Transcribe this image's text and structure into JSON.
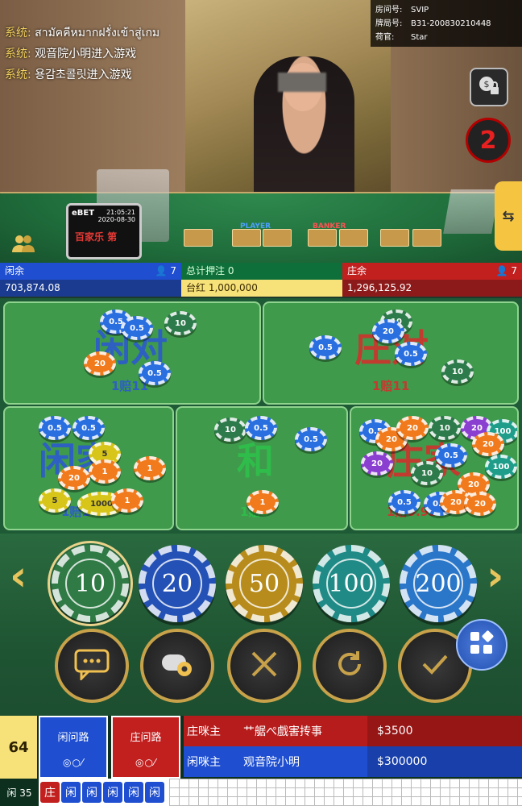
{
  "system_messages": [
    {
      "label": "系统:",
      "text": "สามัคคีหมากฝรั่งเข้าสู่เกม"
    },
    {
      "label": "系统:",
      "text": "观音院小明进入游戏"
    },
    {
      "label": "系统:",
      "text": "용감초콜릿进入游戏"
    }
  ],
  "room": {
    "room_label": "房间号:",
    "room_value": "SVIP",
    "shoe_label": "牌局号:",
    "shoe_value": "B31-200830210448",
    "dealer_label": "荷官:",
    "dealer_value": "Star"
  },
  "screen": {
    "logo": "eBET",
    "time": "21:05:21",
    "date": "2020-08-30",
    "subtitle": "百家乐 第"
  },
  "countdown": "2",
  "table_labels": {
    "player": "PLAYER",
    "banker": "BANKER"
  },
  "stats": {
    "player_label": "闲余",
    "player_count": "7",
    "player_amount": "703,874.08",
    "total_label": "总计押注",
    "total_value": "0",
    "limit_label": "台红",
    "limit_value": "1,000,000",
    "banker_label": "庄余",
    "banker_count": "7",
    "banker_amount": "1,296,125.92"
  },
  "bets": {
    "player_pair": {
      "name": "闲对",
      "odds": "1赔11"
    },
    "banker_pair": {
      "name": "庄对",
      "odds": "1赔11"
    },
    "player": {
      "name": "闲家",
      "odds": "1赔1"
    },
    "tie": {
      "name": "和",
      "odds": "1赔8"
    },
    "banker": {
      "name": "庄家",
      "odds": "1赔0.95"
    }
  },
  "chips": [
    "10",
    "20",
    "50",
    "100",
    "200"
  ],
  "chip_labels": {
    "c05": "0.5",
    "c10": "10",
    "c20": "20",
    "c5": "5",
    "c1000": "1000",
    "c100": "100",
    "c1": "1"
  },
  "selected_chip": "10",
  "bottom": {
    "count": "64",
    "player_road": "闲问路",
    "player_road_icons": "◎○⁄",
    "banker_road": "庄问路",
    "banker_road_icons": "◎○⁄",
    "banker_host_label": "庄咪主",
    "banker_host_name": "艹艍ぺ戲害抟事",
    "banker_host_amount": "$3500",
    "player_host_label": "闲咪主",
    "player_host_name": "观音院小明",
    "player_host_amount": "$300000",
    "player_total": "闲 35",
    "beads": [
      "庄",
      "闲",
      "闲",
      "闲",
      "闲",
      "闲"
    ]
  },
  "colors": {
    "player": "#1f4fd0",
    "banker": "#c21f1f",
    "tie": "#2ec24a",
    "gold": "#e7c45c"
  }
}
